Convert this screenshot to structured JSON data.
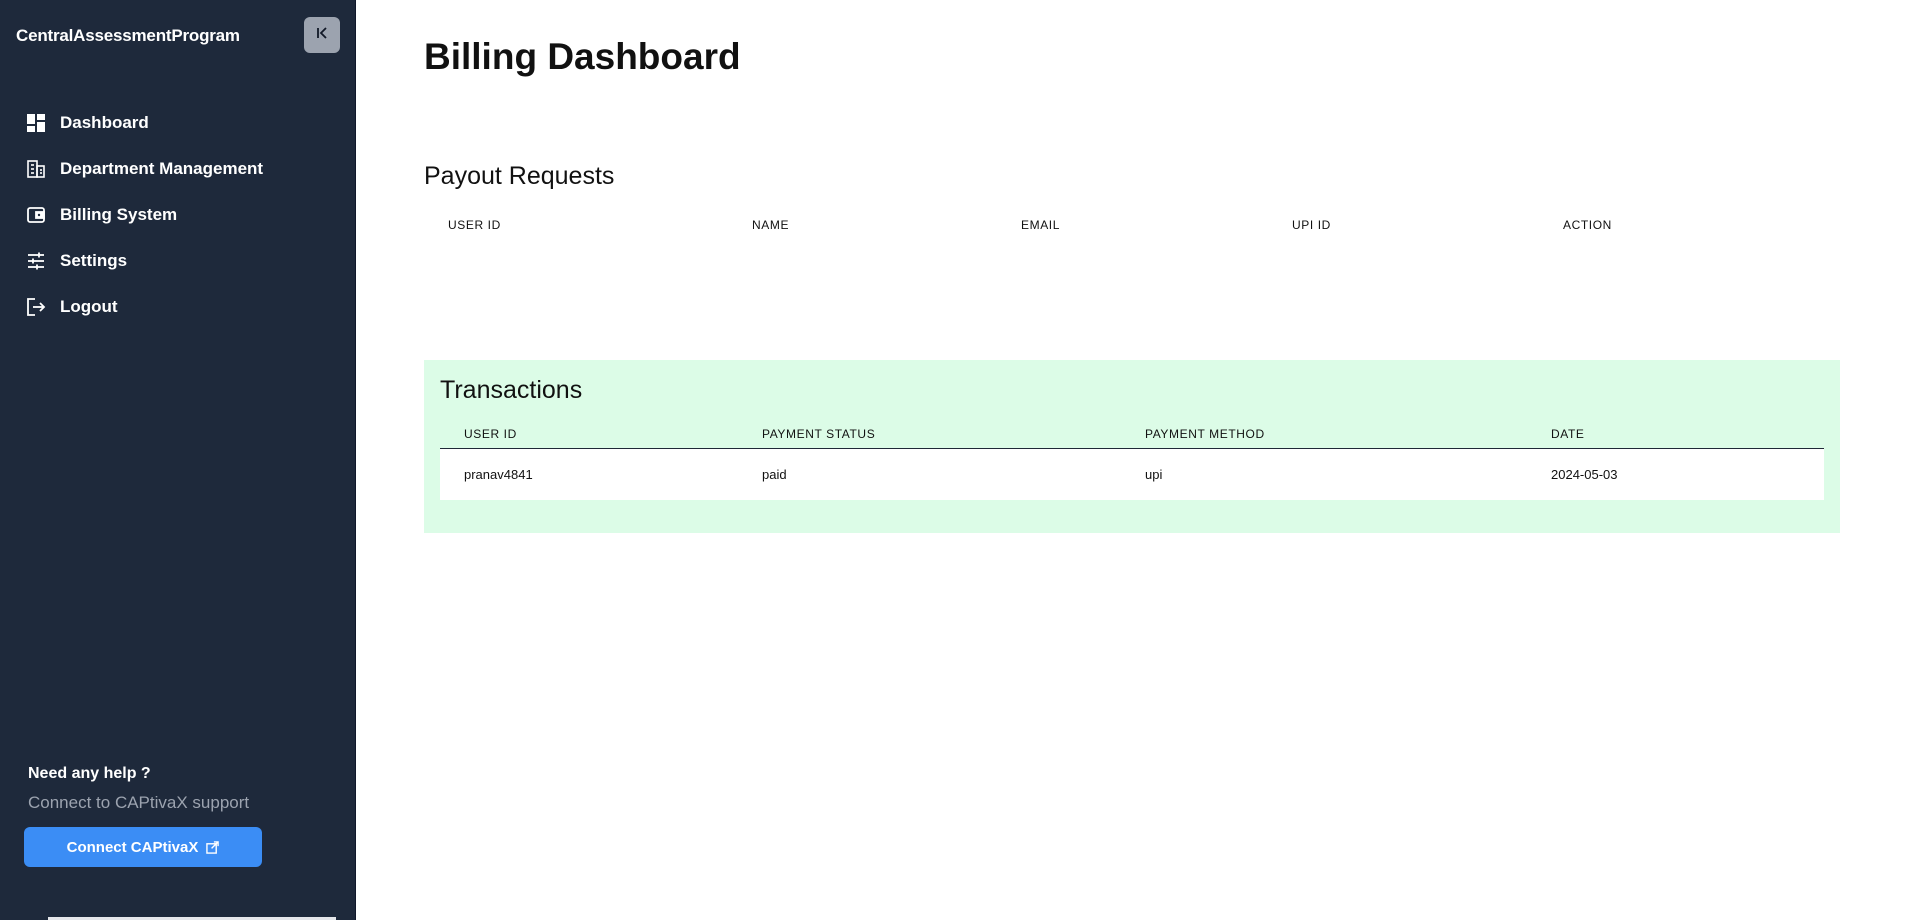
{
  "sidebar": {
    "brand": "CentralAssessmentProgram",
    "items": [
      {
        "label": "Dashboard",
        "icon": "dashboard-icon"
      },
      {
        "label": "Department Management",
        "icon": "building-icon"
      },
      {
        "label": "Billing System",
        "icon": "wallet-icon"
      },
      {
        "label": "Settings",
        "icon": "sliders-icon"
      },
      {
        "label": "Logout",
        "icon": "logout-icon"
      }
    ],
    "help": {
      "title": "Need any help ?",
      "subtitle": "Connect to CAPtivaX support",
      "button_label": "Connect CAPtivaX"
    }
  },
  "main": {
    "title": "Billing Dashboard",
    "payout": {
      "title": "Payout Requests",
      "columns": [
        "USER ID",
        "NAME",
        "EMAIL",
        "UPI ID",
        "ACTION"
      ]
    },
    "transactions": {
      "title": "Transactions",
      "columns": [
        "USER ID",
        "PAYMENT STATUS",
        "PAYMENT METHOD",
        "DATE"
      ],
      "rows": [
        {
          "user_id": "pranav4841",
          "status": "paid",
          "method": "upi",
          "date": "2024-05-03"
        }
      ]
    }
  },
  "colors": {
    "sidebar_bg": "#1e293b",
    "accent": "#3b8df5",
    "transactions_bg": "#dcfce7"
  }
}
